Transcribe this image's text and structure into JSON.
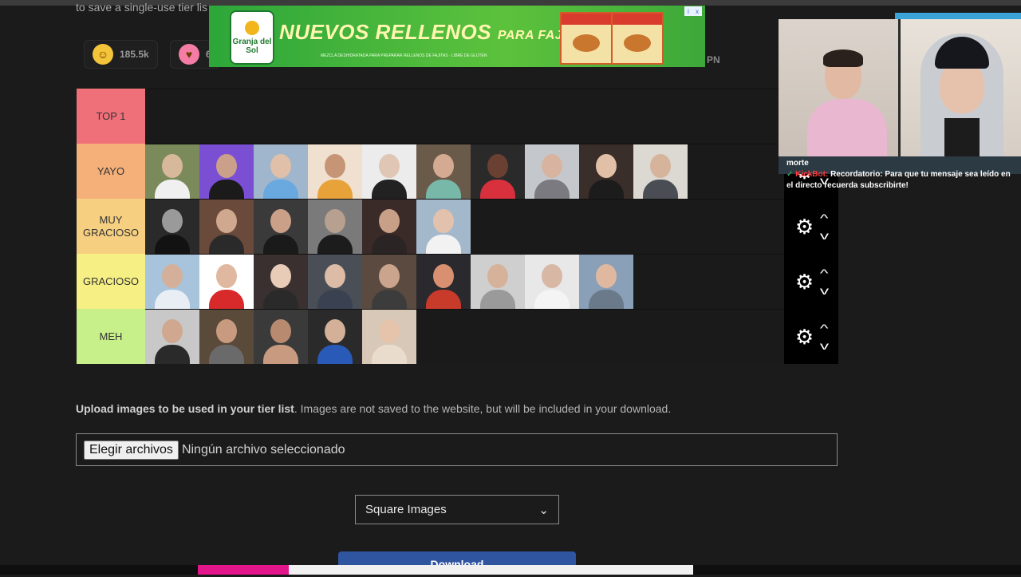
{
  "intro_text": "to save a single-use tier lis",
  "reactions": [
    {
      "emoji_name": "grinning-emoji",
      "count": "185.5k"
    },
    {
      "emoji_name": "heart-eyes-emoji",
      "count": "6"
    }
  ],
  "pn_text": "PN",
  "ad": {
    "brand": "Granja del Sol",
    "headline_1": "NUEVOS",
    "headline_2": "RELLENOS",
    "headline_3": "PARA FAJITAS",
    "fine_print": "MEZCLA DESHIDRATADA PARA PREPARAR RELLENOS DE FAJITAS · LIBRE DE GLUTEN",
    "pack_label": "NUEVO",
    "info_icon": "i",
    "close_icon": "x"
  },
  "tiers": [
    {
      "label": "TOP 1",
      "color": "#f0707a",
      "thumbs": []
    },
    {
      "label": "YAYO",
      "color": "#f5b07a",
      "thumbs": [
        [
          "#7a8a5a",
          "#d8b89a",
          "#f0f0f0"
        ],
        [
          "#7b4fd4",
          "#caa08a",
          "#1b1b1b"
        ],
        [
          "#9fb6cc",
          "#e0c0a8",
          "#6aa8e0"
        ],
        [
          "#f0e0d0",
          "#c69576",
          "#e8a23a"
        ],
        [
          "#ececec",
          "#e0c6b4",
          "#222222"
        ],
        [
          "#6a5a4a",
          "#d4ab92",
          "#78b8a8"
        ],
        [
          "#2a2a2a",
          "#6a4032",
          "#d8303c"
        ],
        [
          "#c4c8cc",
          "#d8b4a0",
          "#7a7a80"
        ],
        [
          "#3a2e2a",
          "#e2c0a8",
          "#1c1c1c"
        ],
        [
          "#dcd8d2",
          "#d6b49c",
          "#4a4e54"
        ]
      ]
    },
    {
      "label": "MUY\nGRACIOSO",
      "color": "#f6cf80",
      "thumbs": [
        [
          "#2a2a2a",
          "#9a9a9a",
          "#121212"
        ],
        [
          "#6a4a3a",
          "#d0a890",
          "#2a2a2a"
        ],
        [
          "#3a3a3a",
          "#caa088",
          "#1a1a1a"
        ],
        [
          "#7a7a7a",
          "#b8a090",
          "#1c1c1c"
        ],
        [
          "#3a2a28",
          "#c8a088",
          "#2a2424"
        ],
        [
          "#a4b8cc",
          "#e2c2ac",
          "#f2f2f2"
        ]
      ]
    },
    {
      "label": "GRACIOSO",
      "color": "#f5ef84",
      "thumbs": [
        [
          "#a8c4dc",
          "#d4b09a",
          "#e8eef4"
        ],
        [
          "#ffffff",
          "#e0b8a0",
          "#d82a2a"
        ],
        [
          "#3a3030",
          "#e8ccb8",
          "#2a2a2a"
        ],
        [
          "#4a4e56",
          "#dcbca6",
          "#3a4252"
        ],
        [
          "#5a4a40",
          "#caa48c",
          "#3c3c3c"
        ],
        [
          "#2a2a2e",
          "#d89070",
          "#c83a2a"
        ],
        [
          "#cfcfcf",
          "#d6b29a",
          "#9a9a9a"
        ],
        [
          "#e8e8e8",
          "#d8b8a4",
          "#f4f4f4"
        ],
        [
          "#8aa0b8",
          "#e0b8a0",
          "#6a7a8a"
        ]
      ]
    },
    {
      "label": "MEH",
      "color": "#c8f08a",
      "thumbs": [
        [
          "#c8c8c8",
          "#d0a890",
          "#2a2a2a"
        ],
        [
          "#5a4a3a",
          "#c89a80",
          "#6a6a6a"
        ],
        [
          "#3a3a3a",
          "#b88a70",
          "#c89a80"
        ],
        [
          "#2a2a2a",
          "#d4b098",
          "#2a5ab8"
        ],
        [
          "#d8c8b8",
          "#e6c4ac",
          "#eadccc"
        ]
      ]
    }
  ],
  "upload_bold": "Upload images to be used in your tier list",
  "upload_rest": ". Images are not saved to the website, but will be included in your download.",
  "file_button": "Elegir archivos",
  "file_status": "Ningún archivo seleccionado",
  "select_value": "Square Images",
  "select_caret": "⌄",
  "download_label": "Download",
  "gear_glyph": "⚙",
  "up_glyph": "^",
  "down_glyph": "v",
  "chat": {
    "line1": "morte",
    "user": "KickBot:",
    "message": "Recordatorio: Para que tu mensaje sea leído en el directo recuerda subscribirte!"
  }
}
